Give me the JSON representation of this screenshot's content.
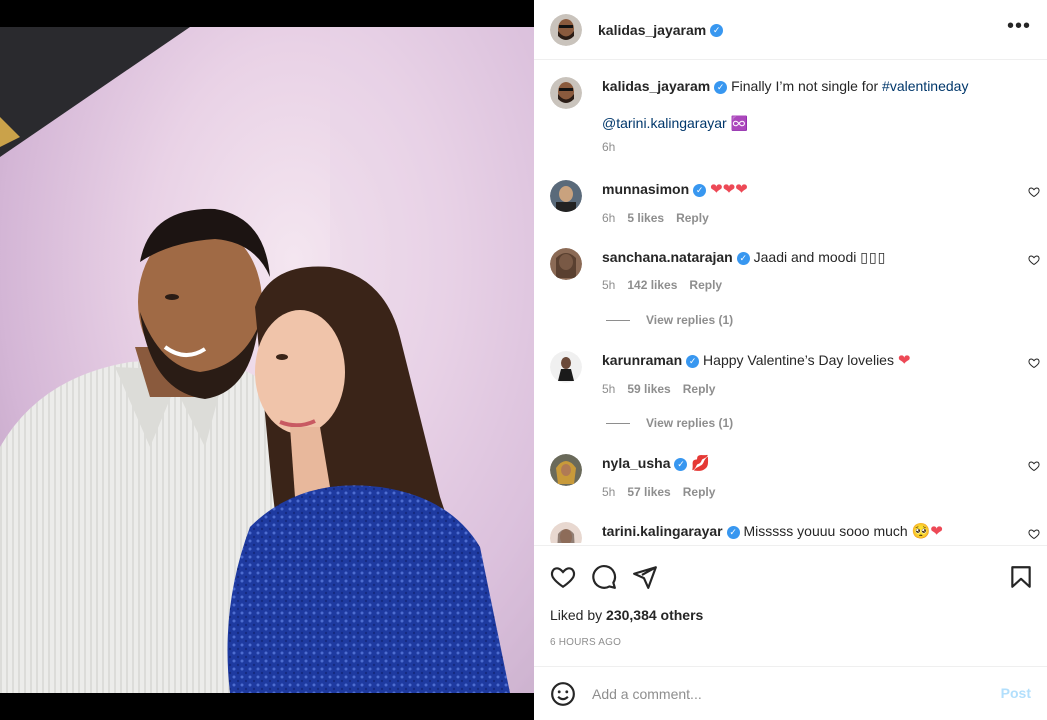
{
  "post": {
    "author": "kalidas_jayaram",
    "verified_mark": "✓",
    "more_icon": "•••",
    "caption": {
      "author": "kalidas_jayaram",
      "text": "Finally I’m not single for",
      "hashtag": "#valentineday",
      "mention": "@tarini.kalingarayar",
      "emoji": "♾️",
      "time": "6h"
    },
    "comments": [
      {
        "user": "munnasimon",
        "text": "",
        "emoji": "❤❤❤",
        "time": "6h",
        "likes": "5 likes",
        "reply": "Reply"
      },
      {
        "user": "sanchana.natarajan",
        "text": "Jaadi and moodi",
        "emoji": "▯▯▯",
        "time": "5h",
        "likes": "142 likes",
        "reply": "Reply",
        "view_replies": "View replies (1)"
      },
      {
        "user": "karunraman",
        "text": "Happy Valentine’s Day lovelies",
        "emoji": "❤",
        "time": "5h",
        "likes": "59 likes",
        "reply": "Reply",
        "view_replies": "View replies (1)"
      },
      {
        "user": "nyla_usha",
        "text": "",
        "emoji": "💋",
        "time": "5h",
        "likes": "57 likes",
        "reply": "Reply"
      },
      {
        "user": "tarini.kalingarayar",
        "text": "Misssss youuu sooo much",
        "emoji": "🥺❤",
        "time": "",
        "likes": "",
        "reply": ""
      }
    ],
    "liked_by_prefix": "Liked by",
    "liked_by_count": "230,384 others",
    "time_ago": "6 HOURS AGO",
    "add_comment_placeholder": "Add a comment...",
    "post_button": "Post",
    "icons": [
      "heart-icon",
      "comment-icon",
      "share-icon",
      "bookmark-icon",
      "emoji-icon"
    ],
    "colors": {
      "verified": "#3897f0",
      "link": "#00376b",
      "heart": "#ed4956",
      "post_button": "#b2dffc",
      "muted": "#8e8e8e"
    }
  }
}
